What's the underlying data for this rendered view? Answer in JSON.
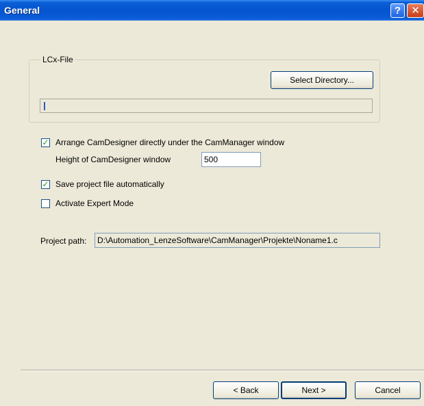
{
  "window": {
    "title": "General",
    "help_glyph": "?",
    "close_glyph": "✕"
  },
  "lcx_group": {
    "label": "LCx-File",
    "select_button": "Select Directory...",
    "path_value": ""
  },
  "options": {
    "arrange": {
      "label": "Arrange CamDesigner directly under the CamManager window",
      "checked": true
    },
    "height_label": "Height of CamDesigner window",
    "height_value": "500",
    "save_project": {
      "label": "Save project file automatically",
      "checked": true
    },
    "expert_mode": {
      "label": "Activate Expert Mode",
      "checked": false
    }
  },
  "project": {
    "label": "Project path:",
    "value": "D:\\Automation_LenzeSoftware\\CamManager\\Projekte\\Noname1.c"
  },
  "footer": {
    "back": "< Back",
    "next": "Next >",
    "cancel": "Cancel"
  },
  "colors": {
    "titlebar": "#0554d0",
    "dialog_bg": "#ece9d8",
    "check_mark": "#21a121"
  },
  "icons": {
    "help": "help-icon",
    "close": "close-icon",
    "check": "checkmark-icon"
  }
}
